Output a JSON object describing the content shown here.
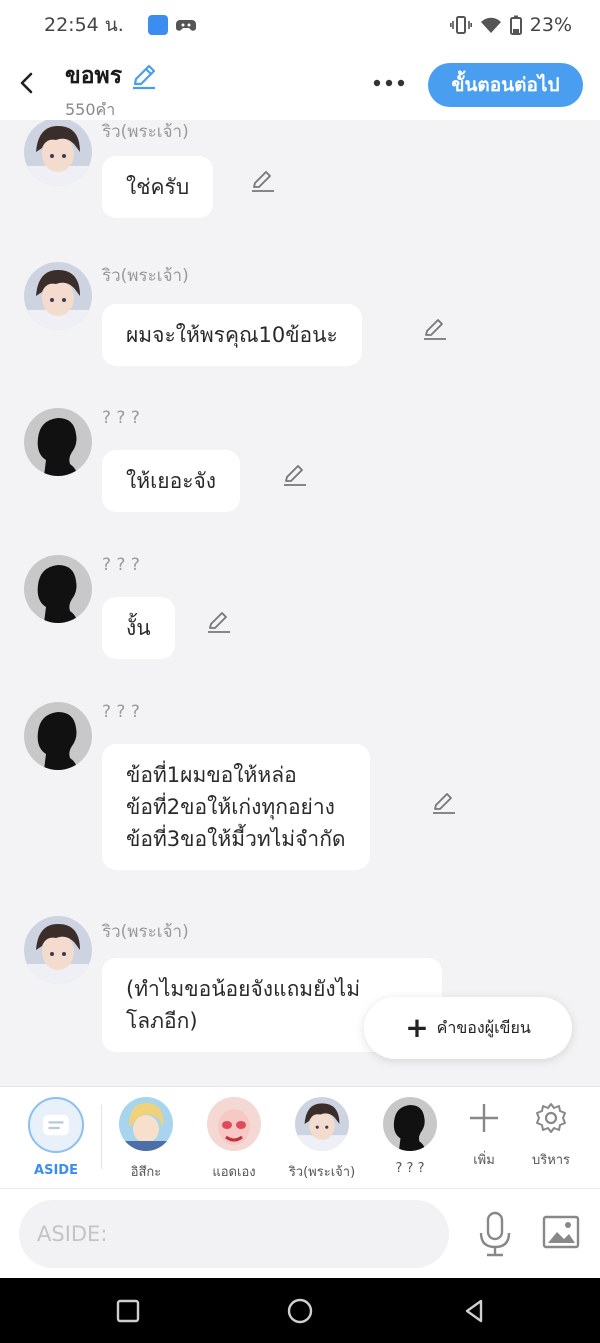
{
  "status": {
    "time": "22:54 น.",
    "app_badge": "NOVEL TOON",
    "battery": "23%"
  },
  "header": {
    "title": "ขอพร",
    "word_count": "550คำ",
    "next_label": "ขั้นตอนต่อไป"
  },
  "messages": [
    {
      "sender": "ริว(พระเจ้า)",
      "text": "ใช่ครับ",
      "avatar": "riu"
    },
    {
      "sender": "ริว(พระเจ้า)",
      "text": "ผมจะให้พรคุณ10ข้อนะ",
      "avatar": "riu"
    },
    {
      "sender": "? ? ?",
      "text": "ให้เยอะจัง",
      "avatar": "silhouette"
    },
    {
      "sender": "? ? ?",
      "text": "งั้น",
      "avatar": "silhouette"
    },
    {
      "sender": "? ? ?",
      "text": "ข้อที่1ผมขอให้หล่อ\nข้อที่2ขอให้เก่งทุกอย่าง\nข้อที่3ขอให้มี้วทไม่จำกัด",
      "avatar": "silhouette"
    },
    {
      "sender": "ริว(พระเจ้า)",
      "text": "(ทำไมขอน้อยจังแถมยังไม่\nโลภอีก)",
      "avatar": "riu"
    }
  ],
  "author_button": {
    "label": "คำของผู้เขียน"
  },
  "characters": [
    {
      "name": "ASIDE",
      "kind": "aside"
    },
    {
      "name": "อิสึกะ",
      "kind": "blonde"
    },
    {
      "name": "แอดเอง",
      "kind": "pink"
    },
    {
      "name": "ริว(พระเจ้า)",
      "kind": "riu"
    },
    {
      "name": "? ? ?",
      "kind": "silhouette"
    }
  ],
  "actions": {
    "add": "เพิ่ม",
    "manage": "บริหาร"
  },
  "input": {
    "placeholder": "ASIDE:"
  },
  "colors": {
    "accent": "#4a9ef0",
    "bubble": "#ffffff",
    "background": "#f3f3f5"
  }
}
